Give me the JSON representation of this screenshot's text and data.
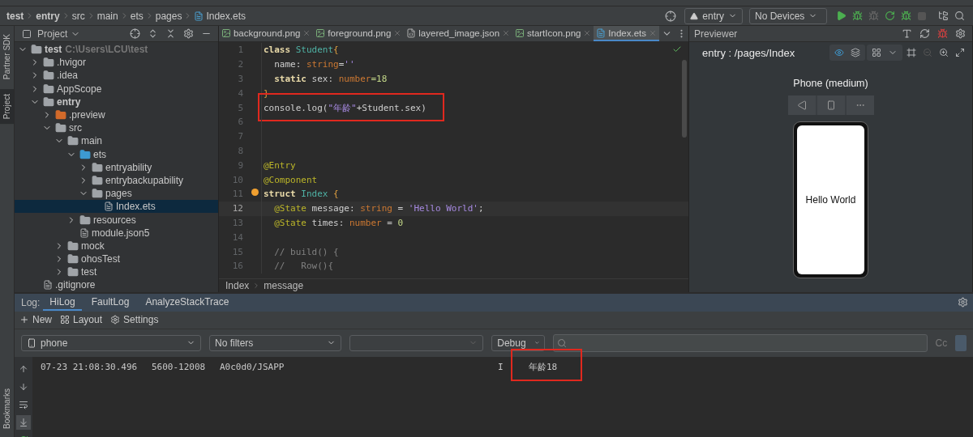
{
  "breadcrumb": [
    {
      "label": "test",
      "kind": "module"
    },
    {
      "label": "entry",
      "kind": "module"
    },
    {
      "label": "src",
      "kind": "folder"
    },
    {
      "label": "main",
      "kind": "folder"
    },
    {
      "label": "ets",
      "kind": "folder"
    },
    {
      "label": "pages",
      "kind": "folder"
    },
    {
      "label": "Index.ets",
      "kind": "file"
    }
  ],
  "run_toolbar": {
    "module": "entry",
    "device": "No Devices"
  },
  "side_tabs": [
    {
      "label": "Partner SDK",
      "selected": false
    },
    {
      "label": "Project",
      "selected": true
    }
  ],
  "bottom_side_tabs": [
    {
      "label": "Bookmarks",
      "selected": false
    }
  ],
  "project": {
    "title": "Project",
    "tree": [
      {
        "label": "test",
        "path": "C:\\Users\\LCU\\test",
        "kind": "module",
        "expanded": true,
        "selected": false,
        "children": [
          {
            "label": ".hvigor",
            "kind": "folder",
            "expanded": false,
            "selected": false
          },
          {
            "label": ".idea",
            "kind": "folder",
            "expanded": false,
            "selected": false
          },
          {
            "label": "AppScope",
            "kind": "folder",
            "expanded": false,
            "selected": false
          },
          {
            "label": "entry",
            "kind": "module",
            "expanded": true,
            "selected": false,
            "children": [
              {
                "label": ".preview",
                "kind": "excluded",
                "expanded": false,
                "selected": false
              },
              {
                "label": "src",
                "kind": "folder",
                "expanded": true,
                "selected": false,
                "children": [
                  {
                    "label": "main",
                    "kind": "folder",
                    "expanded": true,
                    "selected": false,
                    "children": [
                      {
                        "label": "ets",
                        "kind": "source",
                        "expanded": true,
                        "selected": false,
                        "children": [
                          {
                            "label": "entryability",
                            "kind": "folder",
                            "expanded": false,
                            "selected": false
                          },
                          {
                            "label": "entrybackupability",
                            "kind": "folder",
                            "expanded": false,
                            "selected": false
                          },
                          {
                            "label": "pages",
                            "kind": "folder",
                            "expanded": true,
                            "selected": false,
                            "children": [
                              {
                                "label": "Index.ets",
                                "kind": "file",
                                "selected": true
                              }
                            ]
                          }
                        ]
                      },
                      {
                        "label": "resources",
                        "kind": "folder",
                        "expanded": false,
                        "selected": false
                      },
                      {
                        "label": "module.json5",
                        "kind": "file",
                        "selected": false
                      }
                    ]
                  },
                  {
                    "label": "mock",
                    "kind": "folder",
                    "expanded": false,
                    "selected": false
                  },
                  {
                    "label": "ohosTest",
                    "kind": "folder",
                    "expanded": false,
                    "selected": false
                  },
                  {
                    "label": "test",
                    "kind": "folder",
                    "expanded": false,
                    "selected": false
                  }
                ]
              }
            ]
          },
          {
            "label": ".gitignore",
            "kind": "file",
            "selected": false
          }
        ]
      }
    ]
  },
  "editor": {
    "tabs": [
      {
        "label": "background.png",
        "kind": "image",
        "selected": false
      },
      {
        "label": "foreground.png",
        "kind": "image",
        "selected": false
      },
      {
        "label": "layered_image.json",
        "kind": "json",
        "selected": false
      },
      {
        "label": "startIcon.png",
        "kind": "image",
        "selected": false
      },
      {
        "label": "Index.ets",
        "kind": "ets",
        "selected": true
      }
    ],
    "lines": [
      {
        "number": "1",
        "current": false,
        "highlighted": false,
        "tokens": [
          {
            "kind": "keyword",
            "text": "class "
          },
          {
            "kind": "type",
            "text": "Student"
          },
          {
            "kind": "brace",
            "text": "{"
          }
        ]
      },
      {
        "number": "2",
        "current": false,
        "highlighted": false,
        "tokens": [
          {
            "kind": "plain",
            "text": "  name: "
          },
          {
            "kind": "builtin",
            "text": "string"
          },
          {
            "kind": "plain",
            "text": "="
          },
          {
            "kind": "string",
            "text": "''"
          }
        ]
      },
      {
        "number": "3",
        "current": false,
        "highlighted": false,
        "tokens": [
          {
            "kind": "keyword",
            "text": "  static "
          },
          {
            "kind": "plain",
            "text": "sex: "
          },
          {
            "kind": "builtin",
            "text": "number"
          },
          {
            "kind": "number",
            "text": "=18"
          }
        ]
      },
      {
        "number": "4",
        "current": false,
        "highlighted": false,
        "tokens": [
          {
            "kind": "brace",
            "text": "}"
          }
        ]
      },
      {
        "number": "5",
        "current": false,
        "highlighted": true,
        "tokens": [
          {
            "kind": "plain",
            "text": "console.log("
          },
          {
            "kind": "string",
            "text": "\"年龄\""
          },
          {
            "kind": "plain",
            "text": "+Student.sex)"
          }
        ]
      },
      {
        "number": "6",
        "current": false,
        "highlighted": false
      },
      {
        "number": "7",
        "current": false,
        "highlighted": false
      },
      {
        "number": "8",
        "current": false,
        "highlighted": false
      },
      {
        "number": "9",
        "current": false,
        "highlighted": false,
        "tokens": [
          {
            "kind": "decorator",
            "text": "@Entry"
          }
        ]
      },
      {
        "number": "10",
        "current": false,
        "highlighted": false,
        "tokens": [
          {
            "kind": "decorator",
            "text": "@Component"
          }
        ]
      },
      {
        "number": "11",
        "current": false,
        "highlighted": false,
        "tokens": [
          {
            "kind": "keyword",
            "text": "struct "
          },
          {
            "kind": "type",
            "text": "Index "
          },
          {
            "kind": "brace",
            "text": "{"
          }
        ]
      },
      {
        "number": "12",
        "current": true,
        "highlighted": false,
        "tokens": [
          {
            "kind": "decorator",
            "text": "  @State "
          },
          {
            "kind": "plain",
            "text": "message: "
          },
          {
            "kind": "builtin",
            "text": "string"
          },
          {
            "kind": "plain",
            "text": " = "
          },
          {
            "kind": "string",
            "text": "'Hello World'"
          },
          {
            "kind": "plain",
            "text": ";"
          }
        ]
      },
      {
        "number": "13",
        "current": false,
        "highlighted": false,
        "tokens": [
          {
            "kind": "decorator",
            "text": "  @State "
          },
          {
            "kind": "plain",
            "text": "times: "
          },
          {
            "kind": "builtin",
            "text": "number"
          },
          {
            "kind": "plain",
            "text": " = "
          },
          {
            "kind": "number",
            "text": "0"
          }
        ]
      },
      {
        "number": "14",
        "current": false,
        "highlighted": false
      },
      {
        "number": "15",
        "current": false,
        "highlighted": false,
        "tokens": [
          {
            "kind": "comment",
            "text": "  // build() {"
          }
        ]
      },
      {
        "number": "16",
        "current": false,
        "highlighted": false,
        "tokens": [
          {
            "kind": "comment",
            "text": "  //   Row(){"
          }
        ]
      }
    ],
    "path": [
      "Index",
      "message"
    ]
  },
  "previewer": {
    "title": "Previewer",
    "page": "entry : /pages/Index",
    "device": "Phone (medium)",
    "screen_text": "Hello World"
  },
  "log": {
    "label": "Log:",
    "tabs": [
      {
        "label": "HiLog",
        "selected": true
      },
      {
        "label": "FaultLog",
        "selected": false
      },
      {
        "label": "AnalyzeStackTrace",
        "selected": false
      }
    ],
    "actions": [
      "New",
      "Layout",
      "Settings"
    ],
    "device": "phone",
    "filter": "No filters",
    "level": "Debug",
    "match_case": "Cc",
    "rows": [
      {
        "time": "07-23 21:08:30.496",
        "pid": "5600-12008",
        "tag": "A0c0d0/JSAPP",
        "level": "I",
        "message": "年龄18",
        "highlighted": true
      }
    ]
  }
}
